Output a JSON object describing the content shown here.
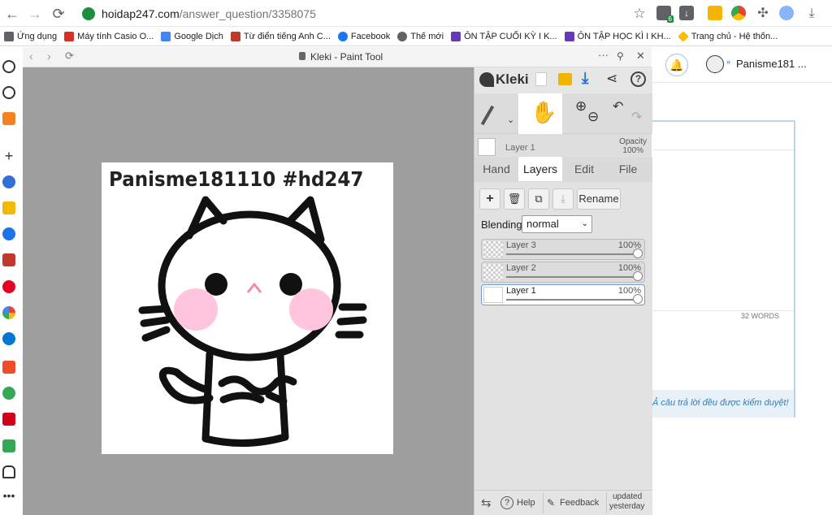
{
  "browser": {
    "url_host": "hoidap247.com",
    "url_path": "/answer_question/3358075",
    "extension_badge": "6"
  },
  "bookmarks": [
    {
      "label": "Ứng dụng",
      "color": "#5f6368"
    },
    {
      "label": "Máy tính Casio O...",
      "color": "#d93025"
    },
    {
      "label": "Google Dịch",
      "color": "#4285f4"
    },
    {
      "label": "Từ điển tiếng Anh C...",
      "color": "#c0392b"
    },
    {
      "label": "Facebook",
      "color": "#1877f2"
    },
    {
      "label": "Thế mới",
      "color": "#5f6368"
    },
    {
      "label": "ÔN TẬP CUỐI KỲ I K...",
      "color": "#673ab7"
    },
    {
      "label": "ÔN TẬP HỌC KÌ I KH...",
      "color": "#673ab7"
    },
    {
      "label": "Trang chủ - Hệ thốn...",
      "color": "#fbbc04"
    }
  ],
  "app": {
    "window_title": "Kleki - Paint Tool",
    "logo": "Kleki",
    "canvas_caption": "Panisme181110 #hd247",
    "current_layer": "Layer 1",
    "opacity_label": "Opacity",
    "opacity_value": "100%",
    "tabs": [
      "Hand",
      "Layers",
      "Edit",
      "File"
    ],
    "active_tab": "Layers",
    "rename_label": "Rename",
    "blending_label": "Blending",
    "blending_value": "normal",
    "layers": [
      {
        "name": "Layer 3",
        "opacity": "100%",
        "selected": false
      },
      {
        "name": "Layer 2",
        "opacity": "100%",
        "selected": false
      },
      {
        "name": "Layer 1",
        "opacity": "100%",
        "selected": true
      }
    ],
    "footer": {
      "help": "Help",
      "feedback": "Feedback",
      "updated_line1": "updated",
      "updated_line2": "yesterday"
    }
  },
  "site": {
    "username": "Panisme181 ...",
    "word_count": "32 WORDS",
    "notice": "Ả câu trả lời đều được kiểm duyệt!"
  }
}
